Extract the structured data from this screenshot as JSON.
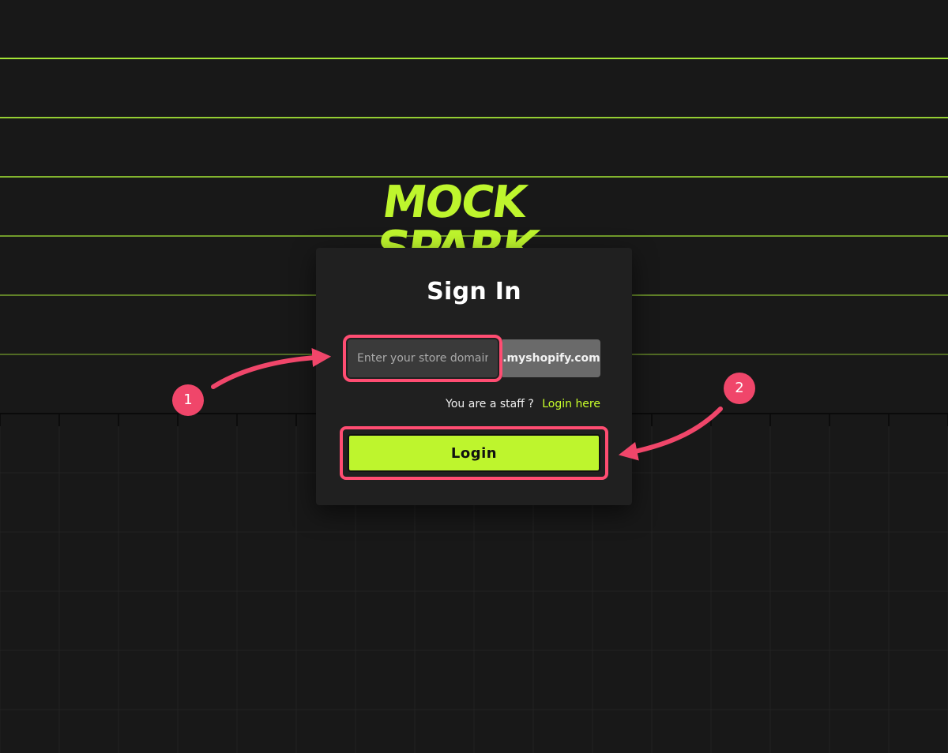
{
  "brand": {
    "logo_line1": "MOCK",
    "logo_line2": "SPARK",
    "accent_color": "#bef52d",
    "highlight_color": "#ff4d72"
  },
  "signin": {
    "title": "Sign In",
    "domain_placeholder": "Enter your store domain",
    "domain_value": "",
    "domain_suffix": ".myshopify.com",
    "staff_prompt": "You are a staff ?",
    "staff_link": "Login here",
    "login_button": "Login"
  },
  "annotations": {
    "step1": "1",
    "step2": "2"
  }
}
